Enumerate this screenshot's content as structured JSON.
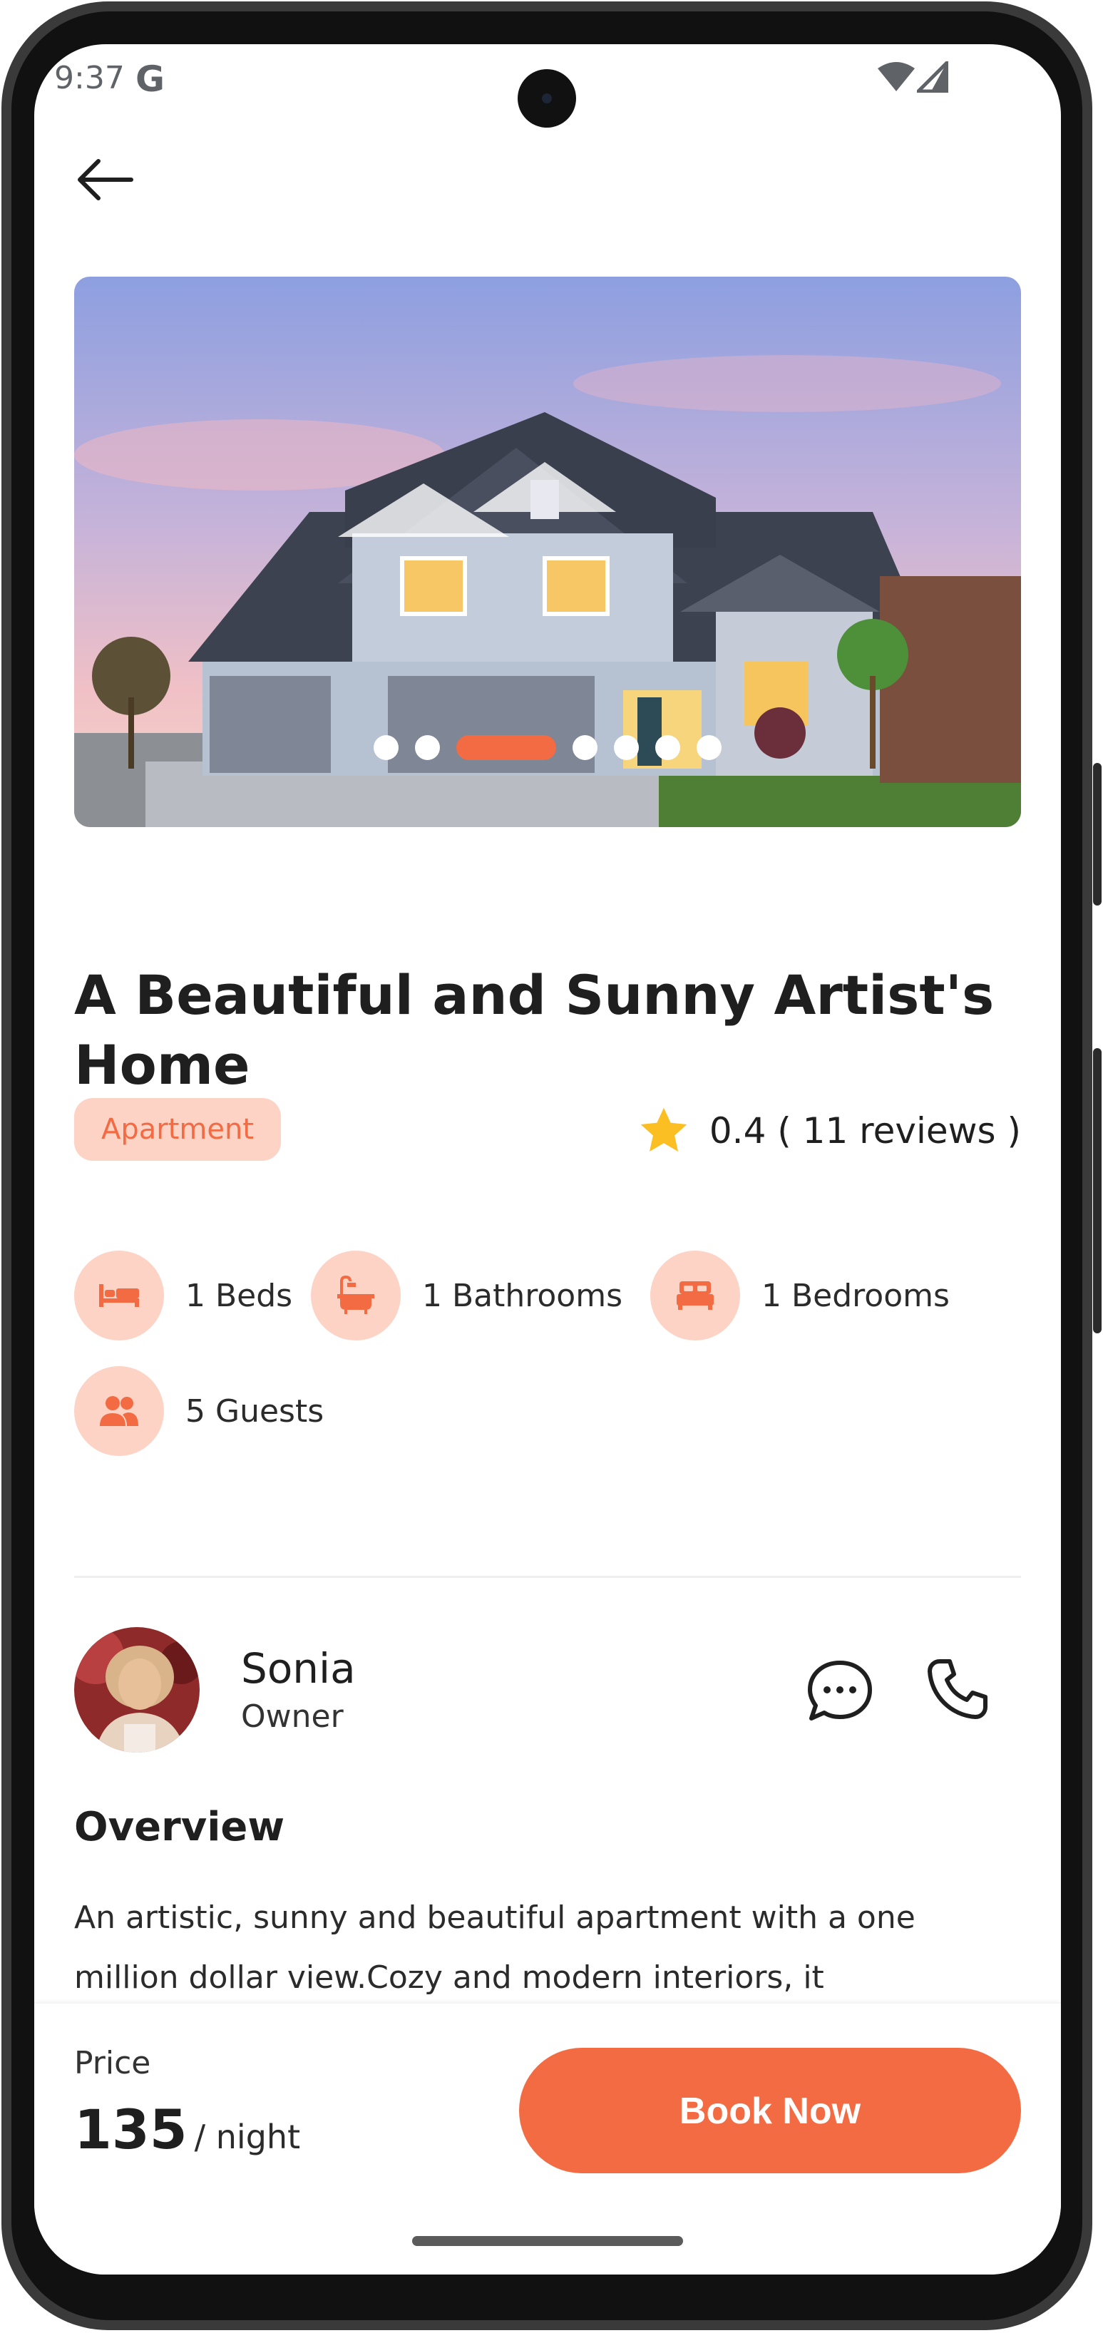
{
  "status_bar": {
    "time": "9:37",
    "g_logo": "G"
  },
  "icons": {
    "back": "arrow-left-icon",
    "star": "star-icon",
    "chat": "chat-bubble-icon",
    "phone": "phone-icon",
    "bed": "bed-icon",
    "bath": "bathtub-icon",
    "bedroom": "double-bed-icon",
    "guests": "people-icon"
  },
  "gallery": {
    "photo": "house-at-dusk-photo",
    "total_images": 7,
    "active_index": 3
  },
  "listing": {
    "title": "A Beautiful and Sunny Artist's Home",
    "type": "Apartment",
    "rating_text": "0.4 ( 11 reviews )"
  },
  "amenities": [
    {
      "label": "1 Beds",
      "icon": "bed-icon"
    },
    {
      "label": "1 Bathrooms",
      "icon": "bathtub-icon"
    },
    {
      "label": "1 Bedrooms",
      "icon": "double-bed-icon"
    },
    {
      "label": "5 Guests",
      "icon": "people-icon"
    }
  ],
  "owner": {
    "name": "Sonia",
    "role": "Owner"
  },
  "overview": {
    "heading": "Overview",
    "text": "An artistic, sunny and beautiful apartment with a one million dollar view.Cozy and modern interiors, it comfortably fits two. Perfect location just one block from"
  },
  "booking": {
    "price_label": "Price",
    "price": "135",
    "unit": "/ night",
    "button": "Book Now"
  },
  "colors": {
    "accent": "#f26b43",
    "accent_light": "#fdd3c6",
    "star": "#fbbf24",
    "text": "#1f1f1f"
  }
}
